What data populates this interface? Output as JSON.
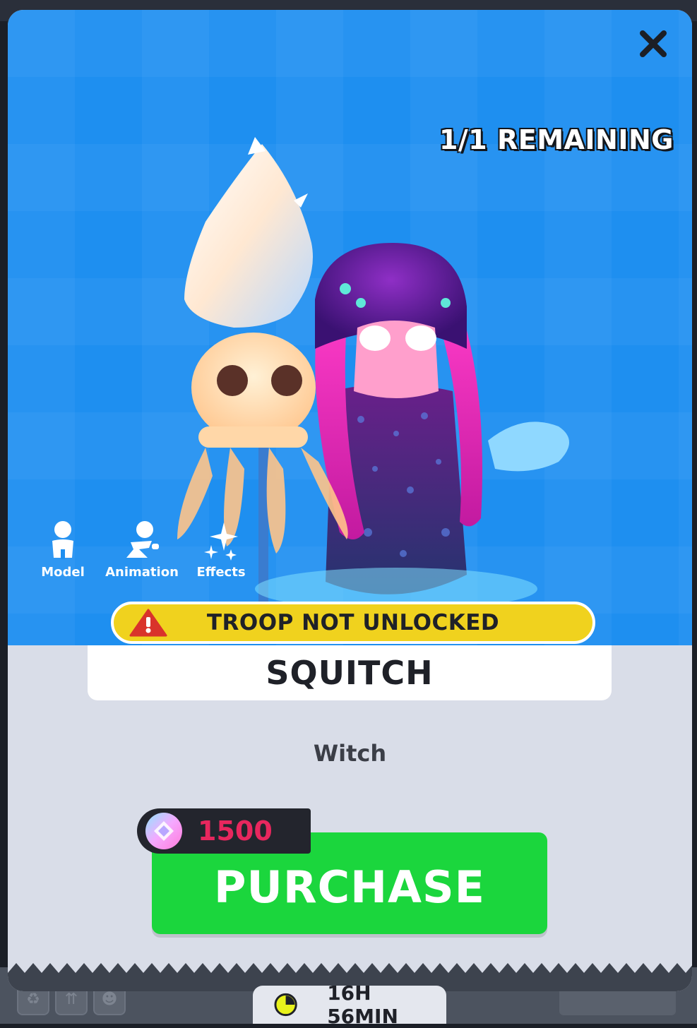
{
  "modal": {
    "close_label": "✕",
    "remaining": "1/1 REMAINING"
  },
  "tools": [
    {
      "label": "Model",
      "icon": "person-icon"
    },
    {
      "label": "Animation",
      "icon": "pose-icon"
    },
    {
      "label": "Effects",
      "icon": "sparkles-icon"
    }
  ],
  "warning": {
    "text": "TROOP NOT UNLOCKED",
    "icon": "warning-triangle-icon"
  },
  "skin": {
    "name": "SQUITCH",
    "subtitle": "Witch"
  },
  "purchase": {
    "label": "PURCHASE",
    "price": "1500",
    "currency_icon": "gem-icon"
  },
  "timer": {
    "text": "16H 56MIN",
    "icon": "clock-icon"
  },
  "colors": {
    "hero_bg": "#1e8ff0",
    "warning_bg": "#f0d21e",
    "button_green": "#1bd63d",
    "price_pink": "#e8275e"
  }
}
